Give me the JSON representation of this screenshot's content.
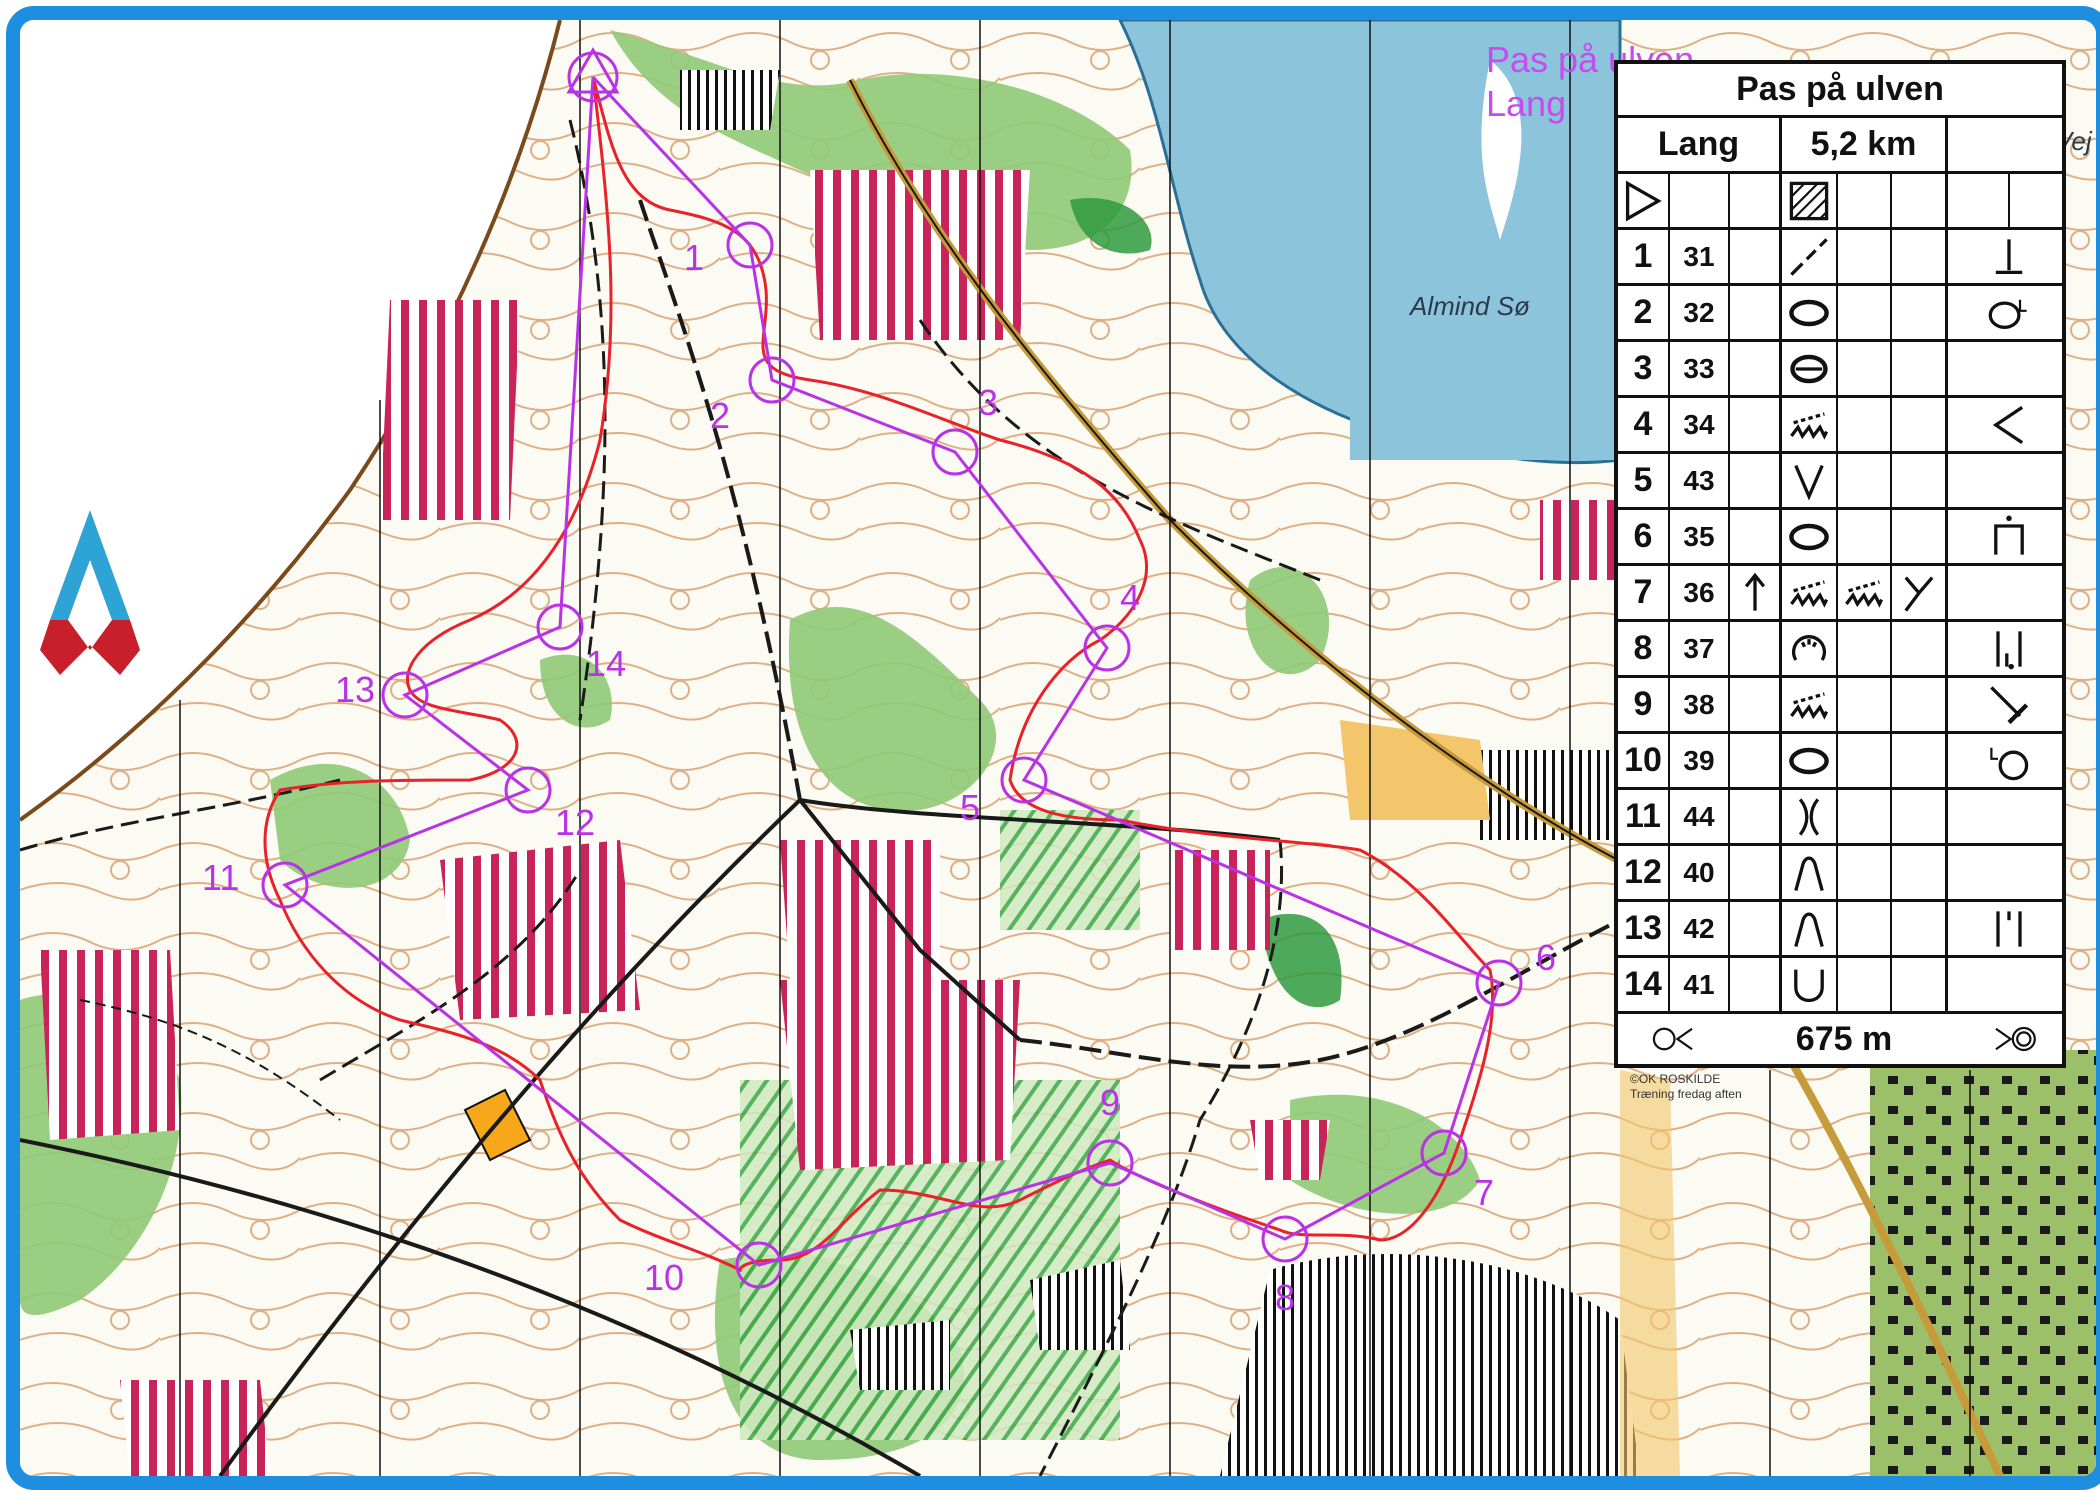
{
  "course": {
    "map_title_line1": "Pas på ulven",
    "map_title_line2": "Lang"
  },
  "map_labels": {
    "lake": "Almind Sø",
    "credit_line1": "©OK ROSKILDE",
    "credit_line2": "Træning fredag aften",
    "edge_label": "Vej"
  },
  "controls": [
    {
      "id": "start",
      "label": ""
    },
    {
      "id": "c1",
      "label": "1"
    },
    {
      "id": "c2",
      "label": "2"
    },
    {
      "id": "c3",
      "label": "3"
    },
    {
      "id": "c4",
      "label": "4"
    },
    {
      "id": "c5",
      "label": "5"
    },
    {
      "id": "c6",
      "label": "6"
    },
    {
      "id": "c7",
      "label": "7"
    },
    {
      "id": "c8",
      "label": "8"
    },
    {
      "id": "c9",
      "label": "9"
    },
    {
      "id": "c10",
      "label": "10"
    },
    {
      "id": "c11",
      "label": "11"
    },
    {
      "id": "c12",
      "label": "12"
    },
    {
      "id": "c13",
      "label": "13"
    },
    {
      "id": "c14",
      "label": "14"
    }
  ],
  "description_sheet": {
    "title": "Pas på ulven",
    "class_name": "Lang",
    "length": "5,2 km",
    "start_feature": "hatched-area",
    "rows": [
      {
        "num": "1",
        "code": "31",
        "feature": "fence-dashed",
        "position": "foot"
      },
      {
        "num": "2",
        "code": "32",
        "feature": "depression",
        "position": "west-part"
      },
      {
        "num": "3",
        "code": "33",
        "feature": "small-depression",
        "position": ""
      },
      {
        "num": "4",
        "code": "34",
        "feature": "ruined-wall",
        "position": "corner"
      },
      {
        "num": "5",
        "code": "43",
        "feature": "re-entrant",
        "position": ""
      },
      {
        "num": "6",
        "code": "35",
        "feature": "depression",
        "position": "top"
      },
      {
        "num": "7",
        "code": "36",
        "direction": "up-arrow",
        "feature": "ruined-wall",
        "feature2": "ruined-wall",
        "appearance": "junction",
        "position": ""
      },
      {
        "num": "8",
        "code": "37",
        "feature": "pit-group",
        "position": "between"
      },
      {
        "num": "9",
        "code": "38",
        "feature": "ruined-wall",
        "position": "end"
      },
      {
        "num": "10",
        "code": "39",
        "feature": "depression",
        "position": "east-part"
      },
      {
        "num": "11",
        "code": "44",
        "feature": "gap",
        "position": ""
      },
      {
        "num": "12",
        "code": "40",
        "feature": "spur",
        "position": ""
      },
      {
        "num": "13",
        "code": "42",
        "feature": "spur",
        "position": "between-lines"
      },
      {
        "num": "14",
        "code": "41",
        "feature": "re-entrant-u",
        "position": ""
      }
    ],
    "finish_distance": "675 m"
  },
  "colors": {
    "frame": "#1e8fe0",
    "water": "#8cc4dc",
    "forest_green": "#8fca77",
    "forest_dark": "#2f9a3e",
    "course_purple": "#b932e6",
    "route_red": "#e8222a",
    "out_of_bounds": "#c8245a",
    "open_yellow": "#f3c66b",
    "building": "#f6a81a",
    "contour": "#c8732c",
    "path_black": "#1a1a1a",
    "north_arrow": "#2ea3d6",
    "north_arrow_base": "#c8202a"
  },
  "icons": {
    "north_arrow": "north-arrow-icon"
  }
}
